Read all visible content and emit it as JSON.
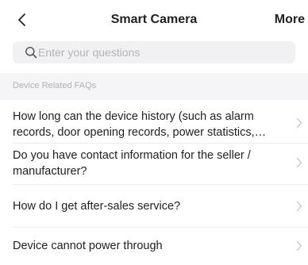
{
  "navbar": {
    "back_icon": "chevron-left-icon",
    "title": "Smart Camera",
    "more_label": "More"
  },
  "search": {
    "icon": "search-icon",
    "placeholder": "Enter your questions",
    "value": ""
  },
  "section": {
    "title": "Device Related FAQs"
  },
  "faqs": [
    {
      "text": "How long can the device history (such as alarm records, door opening records, power statistics, etc.)",
      "icon": "chevron-right-icon"
    },
    {
      "text": "Do you have contact information for the seller / manufacturer?",
      "icon": "chevron-right-icon"
    },
    {
      "text": "How do I get after-sales service?",
      "icon": "chevron-right-icon"
    },
    {
      "text": "Device cannot power through",
      "icon": "chevron-right-icon"
    }
  ],
  "colors": {
    "background": "#ffffff",
    "search_bg": "#f1f1f3",
    "section_bg": "#f5f5f7",
    "text": "#1f1f1f",
    "muted": "#b0b0b4"
  }
}
